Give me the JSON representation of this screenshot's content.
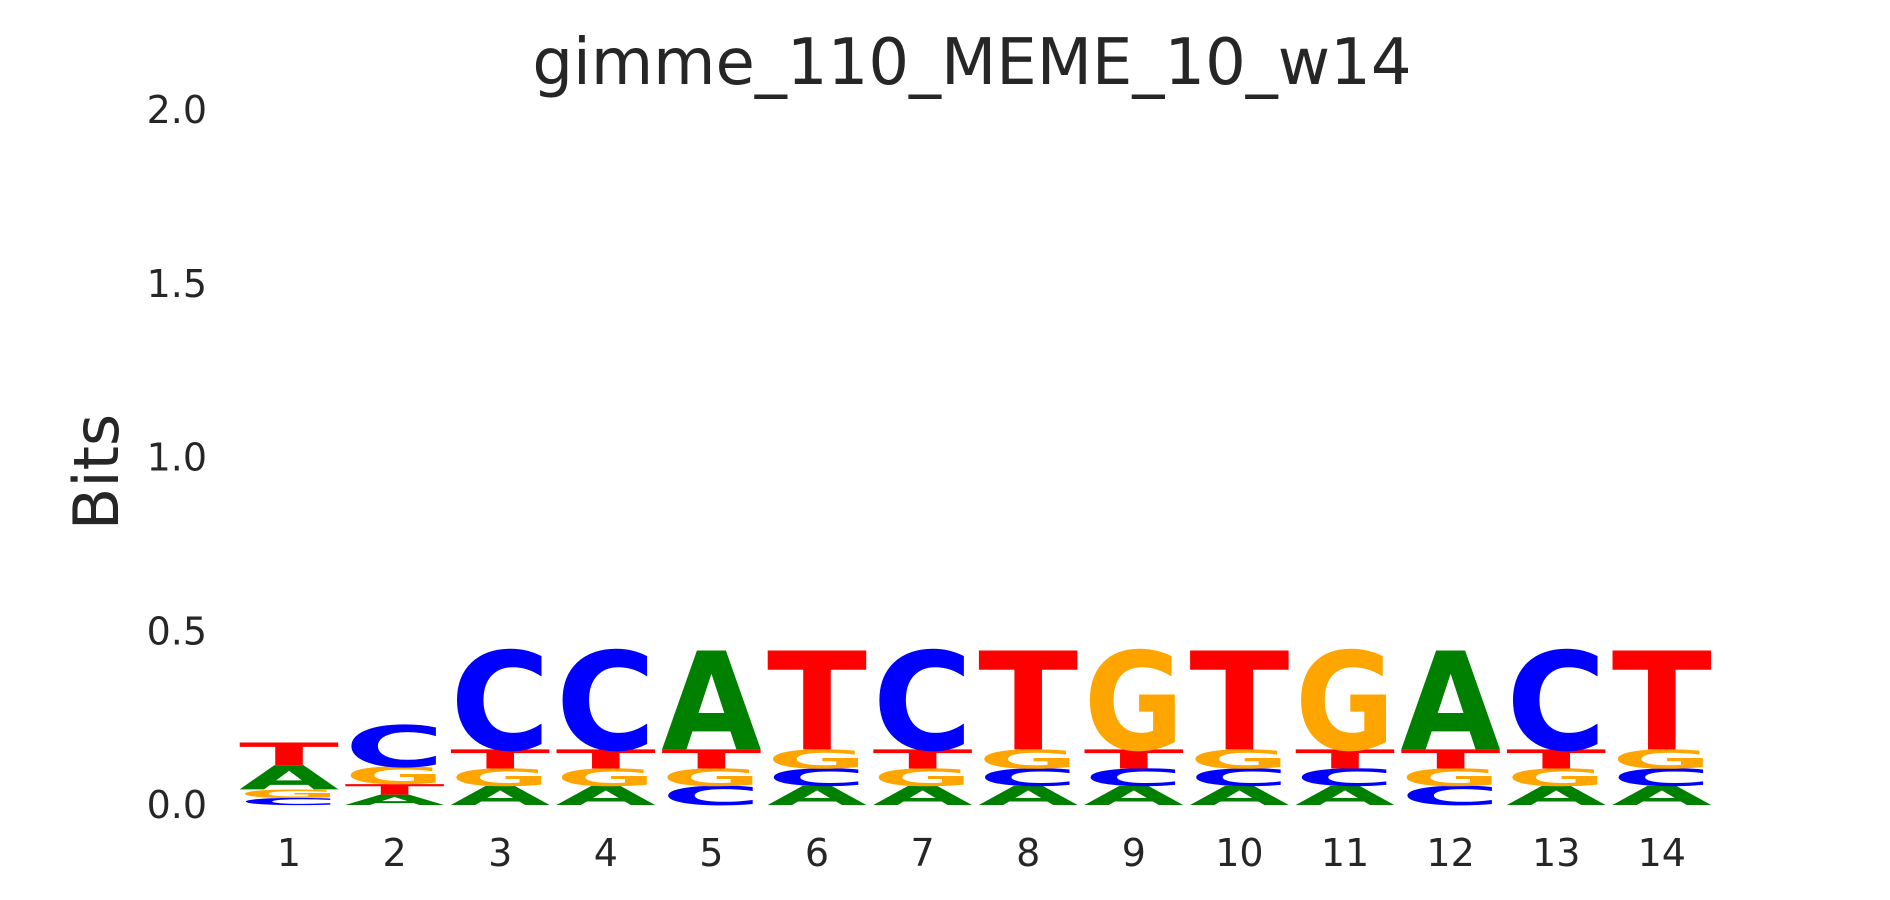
{
  "chart_data": {
    "type": "sequence-logo",
    "title": "gimme_110_MEME_10_w14",
    "ylabel": "Bits",
    "xlabel": "",
    "ylim": [
      0,
      2
    ],
    "yticks": [
      "0.0",
      "0.5",
      "1.0",
      "1.5",
      "2.0"
    ],
    "categories": [
      "1",
      "2",
      "3",
      "4",
      "5",
      "6",
      "7",
      "8",
      "9",
      "10",
      "11",
      "12",
      "13",
      "14"
    ],
    "grid": false,
    "colors": {
      "A": "#008000",
      "C": "#0000ff",
      "G": "#ffa500",
      "T": "#ff0000"
    },
    "positions": [
      {
        "position": "1",
        "stack": [
          [
            "C",
            0.02
          ],
          [
            "G",
            0.025
          ],
          [
            "A",
            0.07
          ],
          [
            "T",
            0.065
          ]
        ]
      },
      {
        "position": "2",
        "stack": [
          [
            "A",
            0.03
          ],
          [
            "T",
            0.03
          ],
          [
            "G",
            0.05
          ],
          [
            "C",
            0.12
          ]
        ]
      },
      {
        "position": "3",
        "stack": [
          [
            "A",
            0.055
          ],
          [
            "G",
            0.05
          ],
          [
            "T",
            0.055
          ],
          [
            "C",
            0.285
          ]
        ]
      },
      {
        "position": "4",
        "stack": [
          [
            "A",
            0.055
          ],
          [
            "G",
            0.05
          ],
          [
            "T",
            0.055
          ],
          [
            "C",
            0.285
          ]
        ]
      },
      {
        "position": "5",
        "stack": [
          [
            "C",
            0.055
          ],
          [
            "G",
            0.05
          ],
          [
            "T",
            0.055
          ],
          [
            "A",
            0.285
          ]
        ]
      },
      {
        "position": "6",
        "stack": [
          [
            "A",
            0.055
          ],
          [
            "C",
            0.05
          ],
          [
            "G",
            0.055
          ],
          [
            "T",
            0.285
          ]
        ]
      },
      {
        "position": "7",
        "stack": [
          [
            "A",
            0.055
          ],
          [
            "G",
            0.05
          ],
          [
            "T",
            0.055
          ],
          [
            "C",
            0.285
          ]
        ]
      },
      {
        "position": "8",
        "stack": [
          [
            "A",
            0.055
          ],
          [
            "C",
            0.05
          ],
          [
            "G",
            0.055
          ],
          [
            "T",
            0.285
          ]
        ]
      },
      {
        "position": "9",
        "stack": [
          [
            "A",
            0.055
          ],
          [
            "C",
            0.05
          ],
          [
            "T",
            0.055
          ],
          [
            "G",
            0.285
          ]
        ]
      },
      {
        "position": "10",
        "stack": [
          [
            "A",
            0.055
          ],
          [
            "C",
            0.05
          ],
          [
            "G",
            0.055
          ],
          [
            "T",
            0.285
          ]
        ]
      },
      {
        "position": "11",
        "stack": [
          [
            "A",
            0.055
          ],
          [
            "C",
            0.05
          ],
          [
            "T",
            0.055
          ],
          [
            "G",
            0.285
          ]
        ]
      },
      {
        "position": "12",
        "stack": [
          [
            "C",
            0.055
          ],
          [
            "G",
            0.05
          ],
          [
            "T",
            0.055
          ],
          [
            "A",
            0.285
          ]
        ]
      },
      {
        "position": "13",
        "stack": [
          [
            "A",
            0.055
          ],
          [
            "G",
            0.05
          ],
          [
            "T",
            0.055
          ],
          [
            "C",
            0.285
          ]
        ]
      },
      {
        "position": "14",
        "stack": [
          [
            "A",
            0.055
          ],
          [
            "C",
            0.05
          ],
          [
            "G",
            0.055
          ],
          [
            "T",
            0.285
          ]
        ]
      }
    ]
  }
}
